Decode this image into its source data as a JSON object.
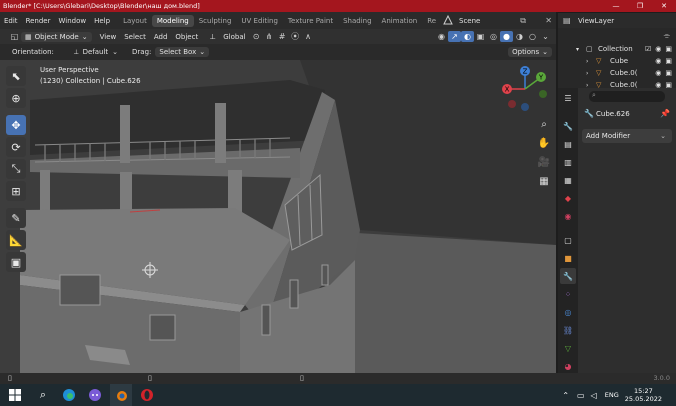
{
  "window": {
    "title": "Blender* [C:\\Users\\Glebari\\Desktop\\Blender\\наш дом.blend]",
    "minimize": "—",
    "maximize": "❐",
    "close": "✕"
  },
  "menus": [
    "Edit",
    "Render",
    "Window",
    "Help"
  ],
  "workspaces": [
    "Layout",
    "Modeling",
    "Sculpting",
    "UV Editing",
    "Texture Paint",
    "Shading",
    "Animation",
    "Re"
  ],
  "active_workspace": "Modeling",
  "scene": {
    "label": "Scene"
  },
  "view_layer": {
    "label": "ViewLayer"
  },
  "viewport_header": {
    "mode": "Object Mode",
    "menus": [
      "View",
      "Select",
      "Add",
      "Object"
    ],
    "transform_orientation": "Global"
  },
  "tool_settings": {
    "orientation_label": "Orientation:",
    "orientation_value": "Default",
    "drag_label": "Drag:",
    "drag_value": "Select Box",
    "options": "Options"
  },
  "viewport": {
    "perspective": "User Perspective",
    "collection_info": "(1230) Collection | Cube.626"
  },
  "gizmo": {
    "x": "X",
    "y": "Y",
    "z": "Z"
  },
  "outliner": {
    "rows": [
      {
        "name": "Collection",
        "type": "collection"
      },
      {
        "name": "Cube",
        "type": "mesh"
      },
      {
        "name": "Cube.0(",
        "type": "mesh"
      },
      {
        "name": "Cube.0(",
        "type": "mesh"
      }
    ]
  },
  "properties": {
    "object_name": "Cube.626",
    "add_modifier": "Add Modifier"
  },
  "status": {
    "version": "3.0.0"
  },
  "taskbar": {
    "language": "ENG",
    "time": "15:27",
    "date": "25.05.2022"
  },
  "colors": {
    "titlebar": "#a4161e",
    "accent_blue": "#4772b3",
    "axis_x": "#e0424b",
    "axis_y": "#5aa83a",
    "axis_z": "#3d7fd6"
  }
}
